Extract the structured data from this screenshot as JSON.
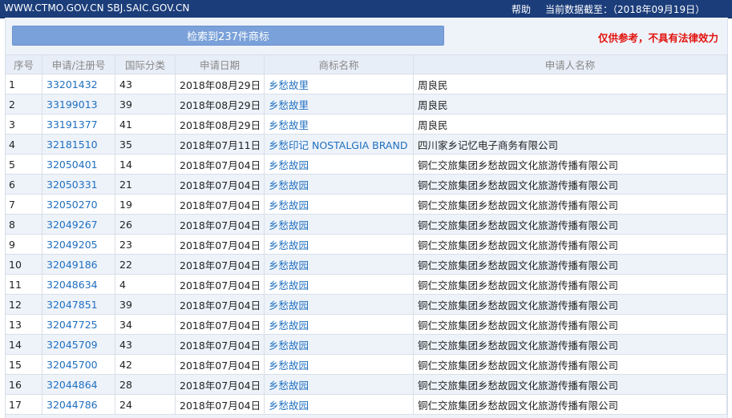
{
  "topbar": {
    "site": "WWW.CTMO.GOV.CN SBJ.SAIC.GOV.CN",
    "help": "帮助",
    "data_date": "当前数据截至：（2018年09月19日）"
  },
  "search": {
    "result_button": "检索到237件商标",
    "disclaimer": "仅供参考，不具有法律效力"
  },
  "columns": [
    "序号",
    "申请/注册号",
    "国际分类",
    "申请日期",
    "商标名称",
    "申请人名称"
  ],
  "rows": [
    {
      "no": "1",
      "reg": "33201432",
      "cls": "43",
      "date": "2018年08月29日",
      "mark": "乡愁故里",
      "applicant": "周良民"
    },
    {
      "no": "2",
      "reg": "33199013",
      "cls": "39",
      "date": "2018年08月29日",
      "mark": "乡愁故里",
      "applicant": "周良民"
    },
    {
      "no": "3",
      "reg": "33191377",
      "cls": "41",
      "date": "2018年08月29日",
      "mark": "乡愁故里",
      "applicant": "周良民"
    },
    {
      "no": "4",
      "reg": "32181510",
      "cls": "35",
      "date": "2018年07月11日",
      "mark": "乡愁印记 NOSTALGIA BRAND",
      "applicant": "四川家乡记忆电子商务有限公司"
    },
    {
      "no": "5",
      "reg": "32050401",
      "cls": "14",
      "date": "2018年07月04日",
      "mark": "乡愁故园",
      "applicant": "铜仁交旅集团乡愁故园文化旅游传播有限公司"
    },
    {
      "no": "6",
      "reg": "32050331",
      "cls": "21",
      "date": "2018年07月04日",
      "mark": "乡愁故园",
      "applicant": "铜仁交旅集团乡愁故园文化旅游传播有限公司"
    },
    {
      "no": "7",
      "reg": "32050270",
      "cls": "19",
      "date": "2018年07月04日",
      "mark": "乡愁故园",
      "applicant": "铜仁交旅集团乡愁故园文化旅游传播有限公司"
    },
    {
      "no": "8",
      "reg": "32049267",
      "cls": "26",
      "date": "2018年07月04日",
      "mark": "乡愁故园",
      "applicant": "铜仁交旅集团乡愁故园文化旅游传播有限公司"
    },
    {
      "no": "9",
      "reg": "32049205",
      "cls": "23",
      "date": "2018年07月04日",
      "mark": "乡愁故园",
      "applicant": "铜仁交旅集团乡愁故园文化旅游传播有限公司"
    },
    {
      "no": "10",
      "reg": "32049186",
      "cls": "22",
      "date": "2018年07月04日",
      "mark": "乡愁故园",
      "applicant": "铜仁交旅集团乡愁故园文化旅游传播有限公司"
    },
    {
      "no": "11",
      "reg": "32048634",
      "cls": "4",
      "date": "2018年07月04日",
      "mark": "乡愁故园",
      "applicant": "铜仁交旅集团乡愁故园文化旅游传播有限公司"
    },
    {
      "no": "12",
      "reg": "32047851",
      "cls": "39",
      "date": "2018年07月04日",
      "mark": "乡愁故园",
      "applicant": "铜仁交旅集团乡愁故园文化旅游传播有限公司"
    },
    {
      "no": "13",
      "reg": "32047725",
      "cls": "34",
      "date": "2018年07月04日",
      "mark": "乡愁故园",
      "applicant": "铜仁交旅集团乡愁故园文化旅游传播有限公司"
    },
    {
      "no": "14",
      "reg": "32045709",
      "cls": "43",
      "date": "2018年07月04日",
      "mark": "乡愁故园",
      "applicant": "铜仁交旅集团乡愁故园文化旅游传播有限公司"
    },
    {
      "no": "15",
      "reg": "32045700",
      "cls": "42",
      "date": "2018年07月04日",
      "mark": "乡愁故园",
      "applicant": "铜仁交旅集团乡愁故园文化旅游传播有限公司"
    },
    {
      "no": "16",
      "reg": "32044864",
      "cls": "28",
      "date": "2018年07月04日",
      "mark": "乡愁故园",
      "applicant": "铜仁交旅集团乡愁故园文化旅游传播有限公司"
    },
    {
      "no": "17",
      "reg": "32044786",
      "cls": "24",
      "date": "2018年07月04日",
      "mark": "乡愁故园",
      "applicant": "铜仁交旅集团乡愁故园文化旅游传播有限公司"
    }
  ]
}
